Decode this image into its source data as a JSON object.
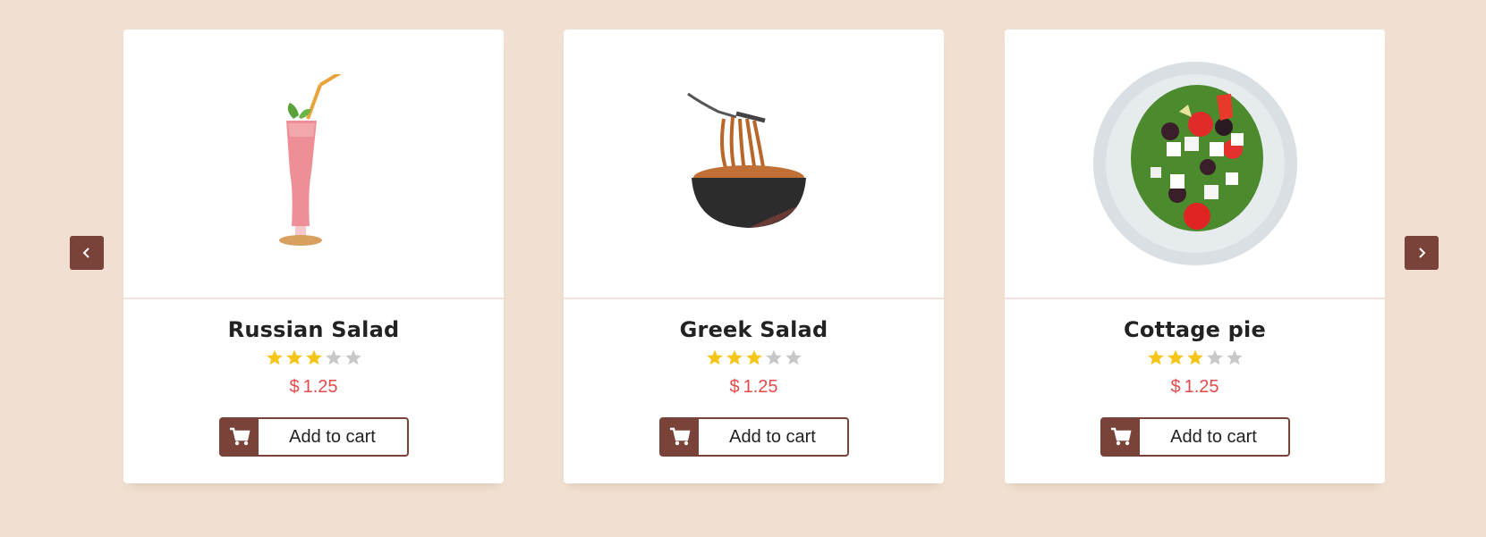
{
  "carousel": {
    "prev_icon": "chevron-left-icon",
    "next_icon": "chevron-right-icon",
    "accent_color": "#7a4339",
    "background_color": "#f1e0d1",
    "price_color": "#e34a4a",
    "star_filled_color": "#f5c518",
    "star_empty_color": "#c8c8c8"
  },
  "products": [
    {
      "name": "Russian Salad",
      "rating": 3,
      "rating_max": 5,
      "currency": "$",
      "price": "1.25",
      "cart_label": "Add to cart",
      "image": "strawberry-smoothie-glass"
    },
    {
      "name": "Greek Salad",
      "rating": 3,
      "rating_max": 5,
      "currency": "$",
      "price": "1.25",
      "cart_label": "Add to cart",
      "image": "spaghetti-bowl-with-fork"
    },
    {
      "name": "Cottage pie",
      "rating": 3,
      "rating_max": 5,
      "currency": "$",
      "price": "1.25",
      "cart_label": "Add to cart",
      "image": "salad-plate"
    }
  ]
}
